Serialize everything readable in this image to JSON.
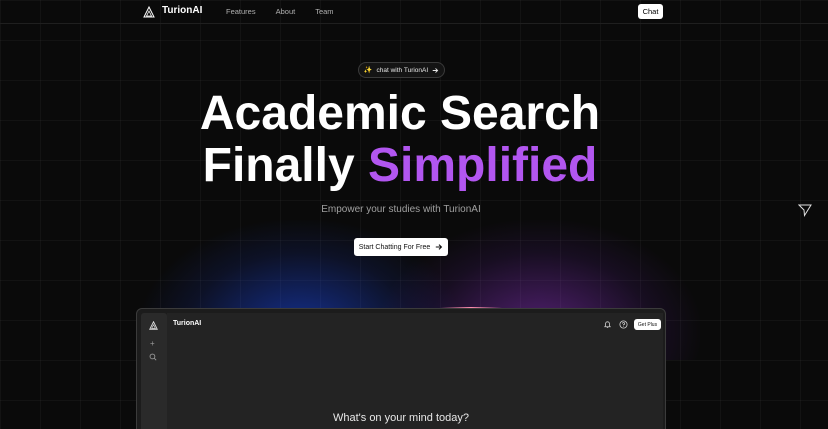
{
  "nav": {
    "brand": "TurionAI",
    "links": [
      "Features",
      "About",
      "Team"
    ],
    "chat_label": "Chat"
  },
  "hero": {
    "pill_label": "chat with TurionAI",
    "headline_line1": "Academic Search",
    "headline_line2_plain": "Finally",
    "headline_line2_accent": "Simplified",
    "subtitle": "Empower your studies with TurionAI",
    "cta_label": "Start Chatting For Free"
  },
  "preview": {
    "brand": "TurionAI",
    "get_plus_label": "Get Plus",
    "prompt": "What's on your mind today?"
  },
  "colors": {
    "background": "#0a0a0a",
    "accent": "#b256f0",
    "button_bg": "#ffffff"
  },
  "icons": {
    "logo": "triangle-logo-icon",
    "pill": "sparkle-icon",
    "cta": "arrow-right-icon",
    "cursor": "cursor-arrow-icon",
    "preview_new": "plus-icon",
    "preview_search": "search-icon",
    "preview_bell": "bell-icon",
    "preview_help": "help-icon"
  }
}
